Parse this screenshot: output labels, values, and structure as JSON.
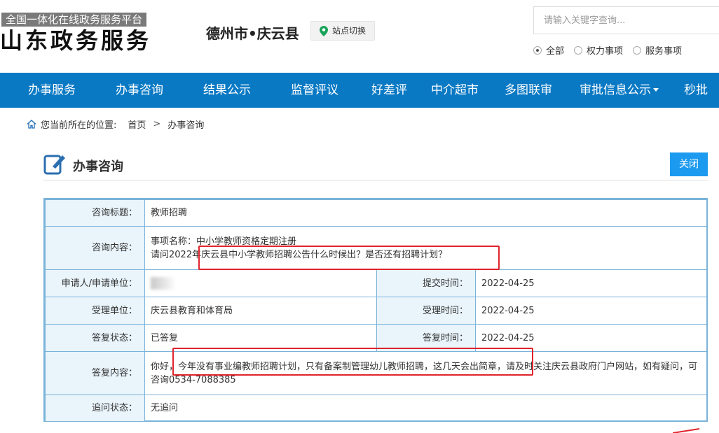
{
  "header": {
    "brand_tag": "全国一体化在线政务服务平台",
    "brand_name": "山东政务服务",
    "region": "德州市•庆云县",
    "switch_label": "站点切换",
    "search_placeholder": "请输入关键字查询...",
    "search_value": "",
    "scope_options": [
      {
        "label": "全部",
        "selected": true
      },
      {
        "label": "权力事项",
        "selected": false
      },
      {
        "label": "服务事项",
        "selected": false
      }
    ]
  },
  "nav": {
    "items": [
      "办事服务",
      "办事咨询",
      "结果公示",
      "监督评议",
      "好差评",
      "中介超市",
      "多图联审",
      "审批信息公示",
      "秒批"
    ]
  },
  "breadcrumb": {
    "prefix": "您当前所在的位置:",
    "home": "首页",
    "separator": ">",
    "current": "办事咨询"
  },
  "panel": {
    "title": "办事咨询",
    "close_label": "关闭"
  },
  "detail": {
    "title_label": "咨询标题：",
    "title_value": "教师招聘",
    "content_label": "咨询内容：",
    "content_line1": "事项名称：中小学教师资格定期注册",
    "content_line2": "请问2022年庆云县中小学教师招聘公告什么时候出？是否还有招聘计划？",
    "applicant_label": "申请人/申请单位：",
    "applicant_value": "王",
    "submit_time_label": "提交时间：",
    "submit_time_value": "2022-04-25",
    "dept_label": "受理单位：",
    "dept_value": "庆云县教育和体育局",
    "accept_time_label": "受理时间：",
    "accept_time_value": "2022-04-25",
    "reply_status_label": "答复状态：",
    "reply_status_value": "已答复",
    "reply_time_label": "答复时间：",
    "reply_time_value": "2022-04-25",
    "reply_content_label": "答复内容：",
    "reply_content_value": "你好，今年没有事业编教师招聘计划，只有备案制管理幼儿教师招聘，这几天会出简章，请及时关注庆云县政府门户网站，如有疑问，可咨询0534-7088385",
    "followup_label": "追问状态：",
    "followup_value": "无追问"
  },
  "colors": {
    "nav_bg": "#0a79c4",
    "close_btn": "#1c9aef",
    "table_border": "#7ab3da",
    "label_bg": "#e9f4fb",
    "highlight": "#e0242c"
  }
}
